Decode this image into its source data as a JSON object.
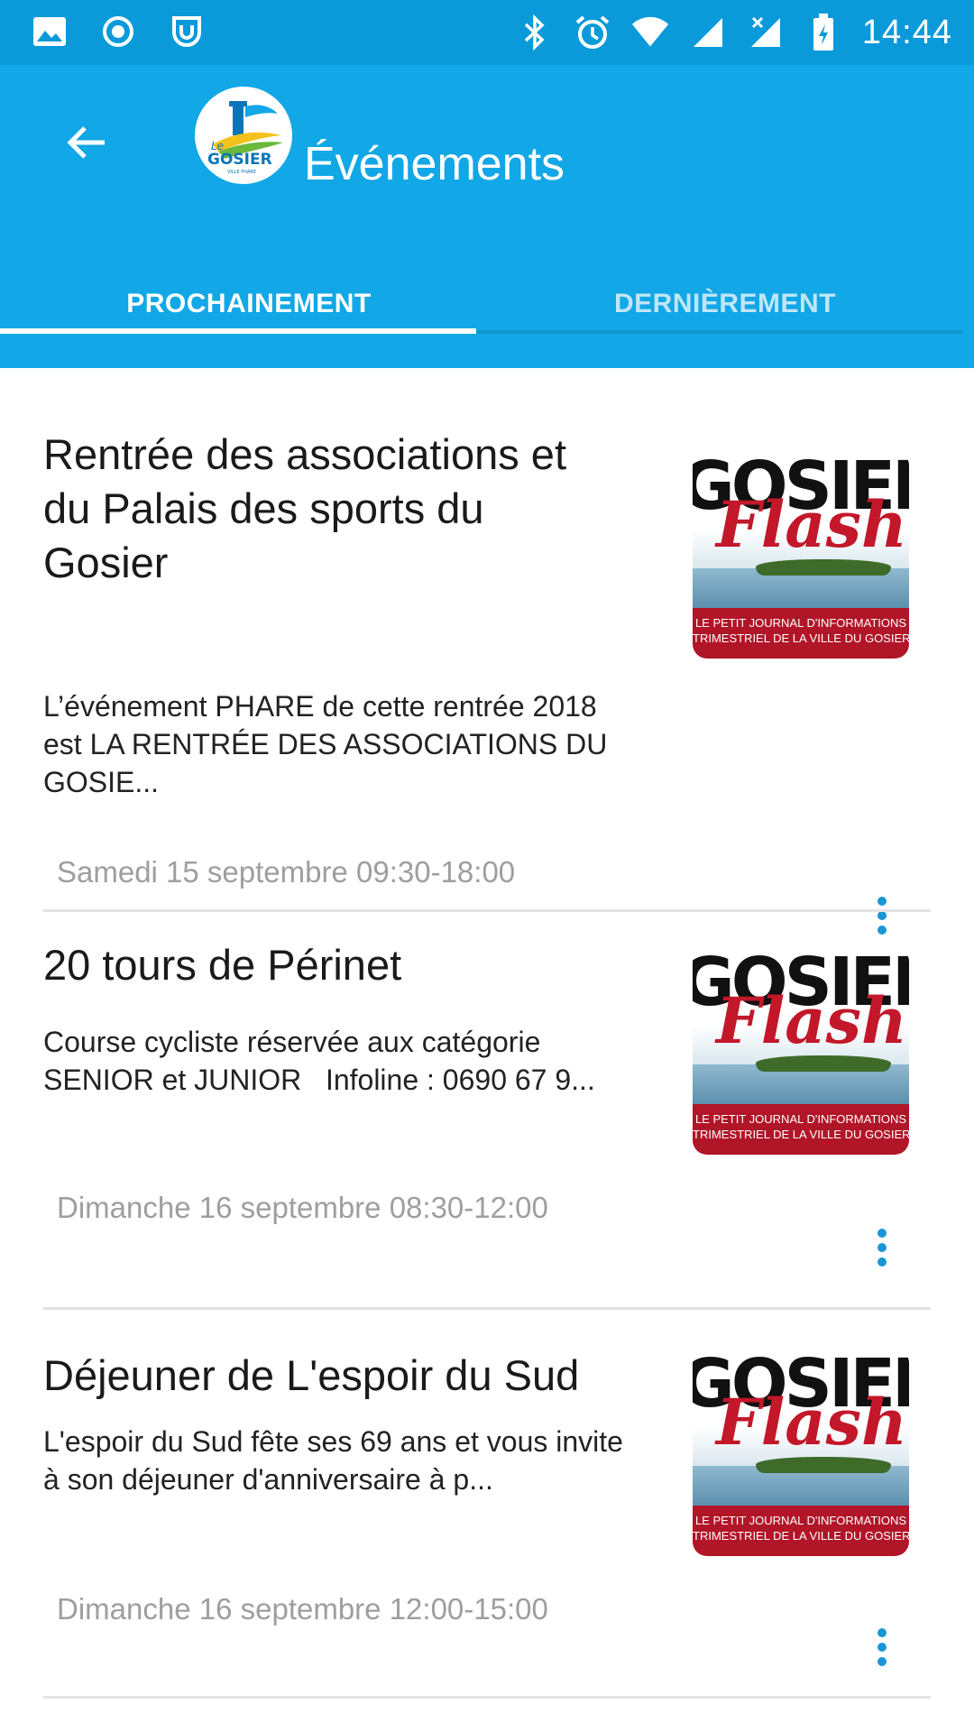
{
  "status_bar": {
    "time": "14:44",
    "left_icons": [
      "image-icon",
      "record-icon",
      "shield-app-icon"
    ],
    "right_icons": [
      "bluetooth-icon",
      "alarm-icon",
      "wifi-icon",
      "signal-icon",
      "signal-x-icon",
      "battery-charging-icon"
    ]
  },
  "app_bar": {
    "title": "Événements",
    "back_icon": "arrow-left-icon",
    "logo_text": "Le GOSIER"
  },
  "tabs": [
    {
      "label": "PROCHAINEMENT",
      "selected": true
    },
    {
      "label": "DERNIÈREMENT",
      "selected": false
    }
  ],
  "thumbnail": {
    "word": "GOSIER",
    "flash": "Flash",
    "band_line1": "LE PETIT JOURNAL D'INFORMATIONS",
    "band_line2": "TRIMESTRIEL DE LA VILLE DU GOSIER"
  },
  "events": [
    {
      "title": "Rentrée des associations et du Palais des sports du Gosier",
      "description": "L’événement PHARE de cette rentrée 2018 est LA RENTRÉE DES ASSOCIATIONS DU GOSIE...",
      "date": "Samedi 15 septembre 09:30-18:00"
    },
    {
      "title": "20 tours de Périnet",
      "description": "Course cycliste réservée aux catégorie SENIOR et JUNIOR   Infoline : 0690 67 9...",
      "date": "Dimanche 16 septembre 08:30-12:00"
    },
    {
      "title": "Déjeuner de L'espoir du Sud",
      "description": "L'espoir du Sud fête ses 69 ans et vous invite à son déjeuner d'anniversaire à p...",
      "date": "Dimanche 16 septembre 12:00-15:00"
    }
  ],
  "colors": {
    "status_bar": "#0a9ad9",
    "app_bar": "#12a7e6",
    "accent": "#1a96d6",
    "date_text": "#9e9e9e"
  }
}
